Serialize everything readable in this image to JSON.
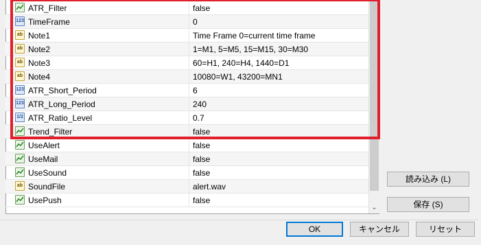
{
  "parameters": [
    {
      "type": "bool",
      "name": "ATR_Filter",
      "value": "false"
    },
    {
      "type": "int",
      "name": "TimeFrame",
      "value": "0"
    },
    {
      "type": "str",
      "name": "Note1",
      "value": "Time Frame 0=current time frame"
    },
    {
      "type": "str",
      "name": "Note2",
      "value": "1=M1, 5=M5, 15=M15, 30=M30"
    },
    {
      "type": "str",
      "name": "Note3",
      "value": "60=H1, 240=H4, 1440=D1"
    },
    {
      "type": "str",
      "name": "Note4",
      "value": "10080=W1, 43200=MN1"
    },
    {
      "type": "int",
      "name": "ATR_Short_Period",
      "value": "6"
    },
    {
      "type": "int",
      "name": "ATR_Long_Period",
      "value": "240"
    },
    {
      "type": "dbl",
      "name": "ATR_Ratio_Level",
      "value": "0.7"
    },
    {
      "type": "bool",
      "name": "Trend_Filter",
      "value": "false"
    },
    {
      "type": "bool",
      "name": "UseAlert",
      "value": "false"
    },
    {
      "type": "bool",
      "name": "UseMail",
      "value": "false"
    },
    {
      "type": "bool",
      "name": "UseSound",
      "value": "false"
    },
    {
      "type": "str",
      "name": "SoundFile",
      "value": "alert.wav"
    },
    {
      "type": "bool",
      "name": "UsePush",
      "value": "false"
    }
  ],
  "icon_text": {
    "bool": "",
    "int": "123",
    "str": "ab",
    "dbl": "1/2"
  },
  "buttons": {
    "load": "読み込み (L)",
    "save": "保存 (S)",
    "ok": "OK",
    "cancel": "キャンセル",
    "reset": "リセット"
  },
  "colors": {
    "highlight": "#e01e2c",
    "primary_border": "#0078d7"
  }
}
